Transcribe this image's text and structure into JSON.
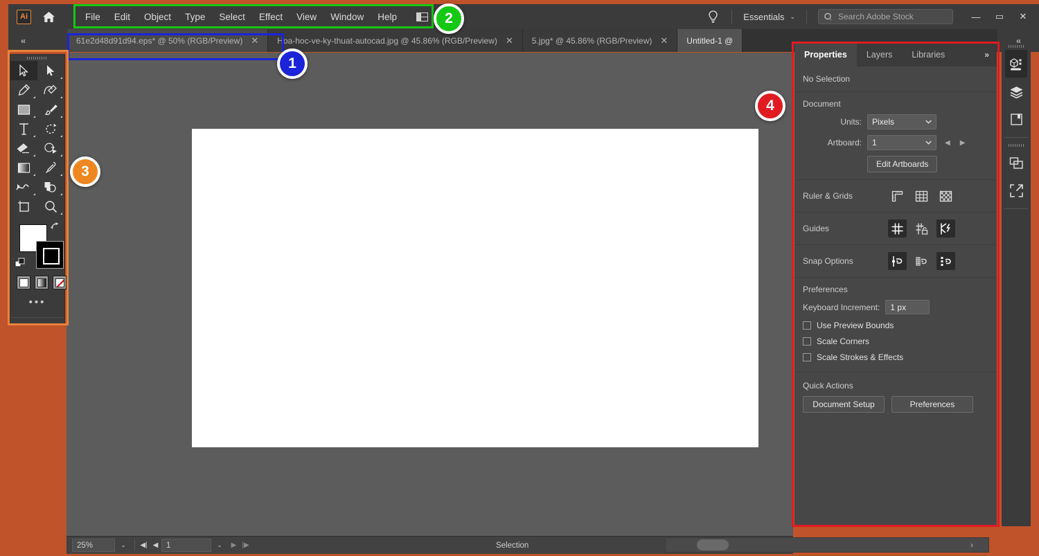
{
  "app": {
    "name": "Adobe Illustrator",
    "logo_text": "Ai"
  },
  "menubar": {
    "items": [
      "File",
      "Edit",
      "Object",
      "Type",
      "Select",
      "Effect",
      "View",
      "Window",
      "Help"
    ],
    "workspace_switcher_caret": "⌄",
    "bulb_icon": "lightbulb-icon",
    "workspace_label": "Essentials",
    "workspace_caret": "⌄",
    "search_placeholder": "Search Adobe Stock",
    "window_buttons": {
      "minimize": "—",
      "maximize": "▭",
      "close": "✕"
    }
  },
  "tabbar": {
    "left_collapse": "‹‹",
    "right_collapse": "‹‹",
    "tabs": [
      {
        "label": "61e2d48d91d94.eps* @ 50% (RGB/Preview)",
        "close": "✕",
        "state": "inactive-highlighted"
      },
      {
        "label": "Hoa-hoc-ve-ky-thuat-autocad.jpg @ 45.86% (RGB/Preview)",
        "close": "✕",
        "state": "inactive"
      },
      {
        "label": "5.jpg* @ 45.86% (RGB/Preview)",
        "close": "✕",
        "state": "inactive"
      },
      {
        "label": "Untitled-1 @",
        "close": "",
        "state": "active"
      }
    ]
  },
  "toolbar": {
    "tools": [
      {
        "name": "selection-tool",
        "glyph": "selection",
        "selected": true,
        "has_flyout": false
      },
      {
        "name": "direct-selection-tool",
        "glyph": "direct-selection",
        "selected": false,
        "has_flyout": true
      },
      {
        "name": "pen-tool",
        "glyph": "pen",
        "selected": false,
        "has_flyout": true
      },
      {
        "name": "curvature-tool",
        "glyph": "curvature",
        "selected": false,
        "has_flyout": true
      },
      {
        "name": "rectangle-tool",
        "glyph": "rectangle",
        "selected": false,
        "has_flyout": true
      },
      {
        "name": "paintbrush-tool",
        "glyph": "paintbrush",
        "selected": false,
        "has_flyout": true
      },
      {
        "name": "type-tool",
        "glyph": "type",
        "selected": false,
        "has_flyout": true
      },
      {
        "name": "rotate-tool",
        "glyph": "rotate",
        "selected": false,
        "has_flyout": true
      },
      {
        "name": "eraser-tool",
        "glyph": "eraser",
        "selected": false,
        "has_flyout": true
      },
      {
        "name": "shape-builder-tool",
        "glyph": "shape-builder",
        "selected": false,
        "has_flyout": true
      },
      {
        "name": "gradient-tool",
        "glyph": "gradient",
        "selected": false,
        "has_flyout": true
      },
      {
        "name": "eyedropper-tool",
        "glyph": "eyedropper",
        "selected": false,
        "has_flyout": true
      },
      {
        "name": "blend-tool",
        "glyph": "blend",
        "selected": false,
        "has_flyout": true
      },
      {
        "name": "symbol-sprayer-tool",
        "glyph": "symbol-sprayer",
        "selected": false,
        "has_flyout": true
      },
      {
        "name": "artboard-tool",
        "glyph": "artboard",
        "selected": false,
        "has_flyout": false
      },
      {
        "name": "zoom-tool",
        "glyph": "zoom",
        "selected": false,
        "has_flyout": true
      }
    ],
    "fill_color": "#ffffff",
    "stroke_color": "#000000",
    "swap_icon": "swap-fill-stroke-icon",
    "default_icon": "default-fill-stroke-icon",
    "draw_modes": [
      "color-swatch",
      "gradient-swatch",
      "none-swatch"
    ],
    "more_tools": "•••"
  },
  "canvas": {
    "background_color": "#5c5c5c",
    "artboard_color": "#ffffff"
  },
  "statusbar": {
    "zoom_level": "25%",
    "zoom_caret": "⌄",
    "first_page": "◀|",
    "prev_page": "◀",
    "page_value": "1",
    "page_caret": "⌄",
    "next_page": "▶",
    "last_page": "|▶",
    "tool_label": "Selection",
    "expand_arrow": "▶",
    "collapse_arrow": "‹",
    "hscroll_arrow": "›"
  },
  "properties_panel": {
    "tabs": [
      {
        "label": "Properties",
        "active": true
      },
      {
        "label": "Layers",
        "active": false
      },
      {
        "label": "Libraries",
        "active": false
      }
    ],
    "more": "»",
    "selection_status": "No Selection",
    "document": {
      "title": "Document",
      "units_label": "Units:",
      "units_value": "Pixels",
      "artboard_label": "Artboard:",
      "artboard_value": "1",
      "prev_artboard": "◀",
      "next_artboard": "▶",
      "edit_artboards_button": "Edit Artboards"
    },
    "ruler_grids": {
      "title": "Ruler & Grids",
      "icons": [
        {
          "name": "show-rulers-icon",
          "active": false
        },
        {
          "name": "show-grid-icon",
          "active": false
        },
        {
          "name": "show-transparency-grid-icon",
          "active": false
        }
      ]
    },
    "guides": {
      "title": "Guides",
      "icons": [
        {
          "name": "show-guides-icon",
          "active": true
        },
        {
          "name": "lock-guides-icon",
          "active": false
        },
        {
          "name": "smart-guides-icon",
          "active": true
        }
      ]
    },
    "snap_options": {
      "title": "Snap Options",
      "icons": [
        {
          "name": "snap-to-point-icon",
          "active": true
        },
        {
          "name": "snap-to-grid-icon",
          "active": false
        },
        {
          "name": "snap-to-pixel-icon",
          "active": true
        }
      ]
    },
    "preferences": {
      "title": "Preferences",
      "keyboard_increment_label": "Keyboard Increment:",
      "keyboard_increment_value": "1 px",
      "checkboxes": [
        {
          "label": "Use Preview Bounds",
          "checked": false
        },
        {
          "label": "Scale Corners",
          "checked": false
        },
        {
          "label": "Scale Strokes & Effects",
          "checked": false
        }
      ]
    },
    "quick_actions": {
      "title": "Quick Actions",
      "buttons": [
        "Document Setup",
        "Preferences"
      ]
    }
  },
  "rail": {
    "icons": [
      {
        "name": "properties-rail-icon",
        "active": true
      },
      {
        "name": "layers-rail-icon",
        "active": false
      },
      {
        "name": "libraries-rail-icon",
        "active": false
      },
      {
        "name": "artboards-rail-icon",
        "active": false
      },
      {
        "name": "asset-export-rail-icon",
        "active": false
      }
    ]
  },
  "annotations": {
    "badges": [
      {
        "number": "1",
        "color": "#1b24d8",
        "target": "document-tab-bar"
      },
      {
        "number": "2",
        "color": "#14c814",
        "target": "menu-bar"
      },
      {
        "number": "3",
        "color": "#ef8721",
        "target": "tools-panel"
      },
      {
        "number": "4",
        "color": "#e11b22",
        "target": "properties-panel"
      }
    ]
  }
}
